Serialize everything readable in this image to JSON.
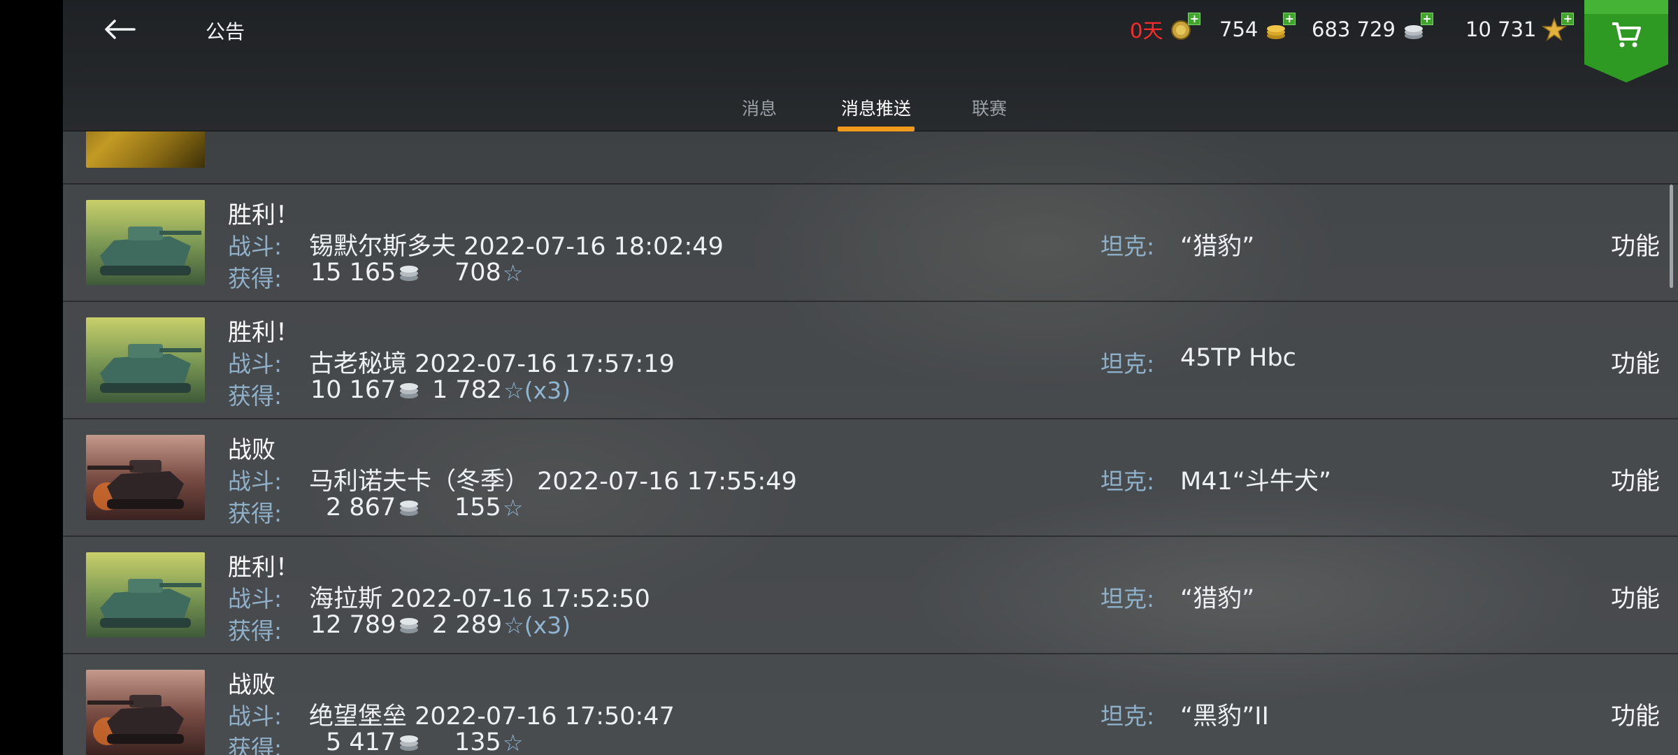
{
  "header": {
    "title": "公告",
    "premium_days": "0天",
    "gold": "754",
    "credits": "683 729",
    "free_xp": "10 731"
  },
  "tabs": [
    {
      "label": "消息",
      "active": false
    },
    {
      "label": "消息推送",
      "active": true
    },
    {
      "label": "联赛",
      "active": false
    }
  ],
  "labels": {
    "battle": "战斗:",
    "earned": "获得:",
    "tank": "坦克:",
    "function": "功能"
  },
  "messages": [
    {
      "result": "胜利！",
      "outcome": "victory",
      "battle": "锡默尔斯多夫 2022-07-16 18:02:49",
      "credits": "15 165",
      "xp": "708",
      "multiplier": "",
      "tank": "“猎豹”"
    },
    {
      "result": "胜利！",
      "outcome": "victory",
      "battle": "古老秘境 2022-07-16 17:57:19",
      "credits": "10 167",
      "xp": "1 782",
      "multiplier": "(x3)",
      "tank": "45TP Hbc"
    },
    {
      "result": "战败",
      "outcome": "defeat",
      "battle": "马利诺夫卡（冬季） 2022-07-16 17:55:49",
      "credits": "2 867",
      "xp": "155",
      "multiplier": "",
      "tank": "M41“斗牛犬”"
    },
    {
      "result": "胜利！",
      "outcome": "victory",
      "battle": "海拉斯 2022-07-16 17:52:50",
      "credits": "12 789",
      "xp": "2 289",
      "multiplier": "(x3)",
      "tank": "“猎豹”"
    },
    {
      "result": "战败",
      "outcome": "defeat",
      "battle": "绝望堡垒 2022-07-16 17:50:47",
      "credits": "5 417",
      "xp": "135",
      "multiplier": "",
      "tank": "“黑豹”II"
    }
  ],
  "colors": {
    "accent_tab": "#f19a1b",
    "premium_red": "#ff2a2a",
    "label_blue": "#8fb0c9",
    "shop_green": "#2f9a23"
  }
}
